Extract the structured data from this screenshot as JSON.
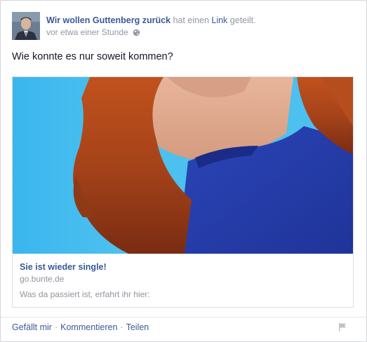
{
  "post": {
    "author": "Wir wollen Guttenberg zurück",
    "action_text": " hat einen ",
    "link_word": "Link",
    "action_suffix": " geteilt.",
    "timestamp": "vor etwa einer Stunde",
    "message": "Wie konnte es nur soweit kommen?"
  },
  "attachment": {
    "title": "Sie ist wieder single!",
    "domain": "go.bunte.de",
    "description": "Was da passiert ist, erfahrt ihr hier:"
  },
  "actions": {
    "like": "Gefällt mir",
    "comment": "Kommentieren",
    "share": "Teilen",
    "separator": "·"
  }
}
